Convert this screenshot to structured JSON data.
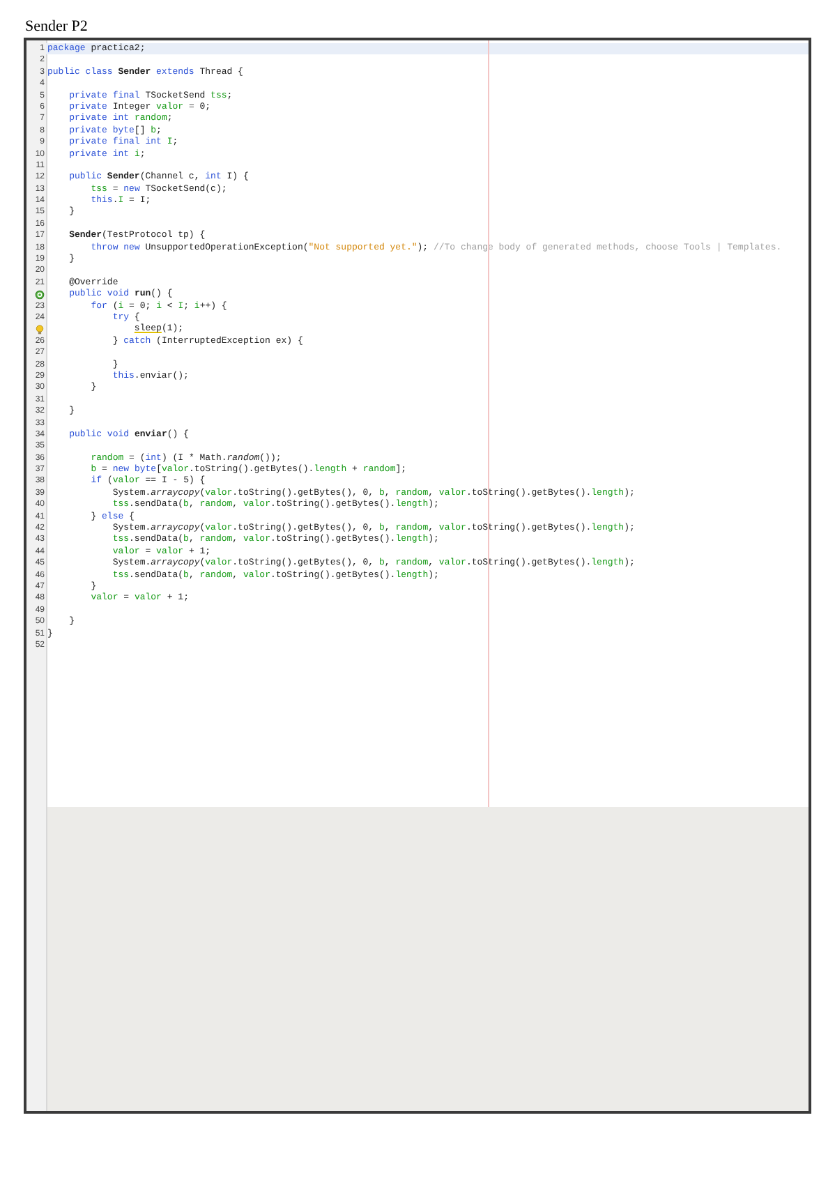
{
  "page_title": "Sender P2",
  "lines": [
    {
      "number": "1",
      "current": true,
      "tokens": [
        {
          "kind": "kw",
          "text": "package"
        },
        {
          "kind": "p",
          "text": " practica2;"
        }
      ]
    },
    {
      "number": "2",
      "current": false
    },
    {
      "number": "3",
      "current": false,
      "tokens": [
        {
          "kind": "kw",
          "text": "public class "
        },
        {
          "kind": "b",
          "text": "Sender"
        },
        {
          "kind": "kw",
          "text": " extends"
        },
        {
          "kind": "p",
          "text": " Thread {"
        }
      ]
    },
    {
      "number": "4",
      "current": false
    },
    {
      "number": "5",
      "current": false,
      "tokens": [
        {
          "kind": "kw",
          "text": "    private final"
        },
        {
          "kind": "p",
          "text": " TSocketSend "
        },
        {
          "kind": "f",
          "text": "tss"
        },
        {
          "kind": "p",
          "text": ";"
        }
      ]
    },
    {
      "number": "6",
      "current": false,
      "tokens": [
        {
          "kind": "kw",
          "text": "    private"
        },
        {
          "kind": "p",
          "text": " Integer "
        },
        {
          "kind": "f",
          "text": "valor"
        },
        {
          "kind": "p",
          "text": " = 0;"
        }
      ]
    },
    {
      "number": "7",
      "current": false,
      "tokens": [
        {
          "kind": "kw",
          "text": "    private int"
        },
        {
          "kind": "f",
          "text": " random"
        },
        {
          "kind": "p",
          "text": ";"
        }
      ]
    },
    {
      "number": "8",
      "current": false,
      "tokens": [
        {
          "kind": "kw",
          "text": "    private byte"
        },
        {
          "kind": "p",
          "text": "[] "
        },
        {
          "kind": "f",
          "text": "b"
        },
        {
          "kind": "p",
          "text": ";"
        }
      ]
    },
    {
      "number": "9",
      "current": false,
      "tokens": [
        {
          "kind": "kw",
          "text": "    private final int"
        },
        {
          "kind": "f",
          "text": " I"
        },
        {
          "kind": "p",
          "text": ";"
        }
      ]
    },
    {
      "number": "10",
      "current": false,
      "tokens": [
        {
          "kind": "kw",
          "text": "    private int"
        },
        {
          "kind": "f",
          "text": " i"
        },
        {
          "kind": "p",
          "text": ";"
        }
      ]
    },
    {
      "number": "11",
      "current": false
    },
    {
      "number": "12",
      "current": false,
      "tokens": [
        {
          "kind": "kw",
          "text": "    public"
        },
        {
          "kind": "b",
          "text": " Sender"
        },
        {
          "kind": "p",
          "text": "(Channel c, "
        },
        {
          "kind": "kw",
          "text": "int"
        },
        {
          "kind": "p",
          "text": " I) {"
        }
      ]
    },
    {
      "number": "13",
      "current": false,
      "tokens": [
        {
          "kind": "f",
          "text": "        tss"
        },
        {
          "kind": "p",
          "text": " = "
        },
        {
          "kind": "kw",
          "text": "new"
        },
        {
          "kind": "p",
          "text": " TSocketSend(c);"
        }
      ]
    },
    {
      "number": "14",
      "current": false,
      "tokens": [
        {
          "kind": "kw",
          "text": "        this"
        },
        {
          "kind": "p",
          "text": "."
        },
        {
          "kind": "f",
          "text": "I"
        },
        {
          "kind": "p",
          "text": " = I;"
        }
      ]
    },
    {
      "number": "15",
      "current": false,
      "tokens": [
        {
          "kind": "p",
          "text": "    }"
        }
      ]
    },
    {
      "number": "16",
      "current": false
    },
    {
      "number": "17",
      "current": false,
      "tokens": [
        {
          "kind": "b",
          "text": "    Sender"
        },
        {
          "kind": "p",
          "text": "(TestProtocol tp) {"
        }
      ]
    },
    {
      "number": "18",
      "current": false,
      "tokens": [
        {
          "kind": "kw",
          "text": "        throw new"
        },
        {
          "kind": "p",
          "text": " UnsupportedOperationException("
        },
        {
          "kind": "s",
          "text": "\"Not supported yet.\""
        },
        {
          "kind": "p",
          "text": "); "
        },
        {
          "kind": "c",
          "text": "//To change body of generated methods, choose Tools | Templates."
        }
      ]
    },
    {
      "number": "19",
      "current": false,
      "tokens": [
        {
          "kind": "p",
          "text": "    }"
        }
      ]
    },
    {
      "number": "20",
      "current": false
    },
    {
      "number": "21",
      "current": false,
      "tokens": [
        {
          "kind": "p",
          "text": "    @Override"
        }
      ]
    },
    {
      "kind": "override",
      "current": false,
      "tokens": [
        {
          "kind": "kw",
          "text": "    public void"
        },
        {
          "kind": "b",
          "text": " run"
        },
        {
          "kind": "p",
          "text": "() {"
        }
      ]
    },
    {
      "number": "23",
      "current": false,
      "tokens": [
        {
          "kind": "kw",
          "text": "        for"
        },
        {
          "kind": "p",
          "text": " ("
        },
        {
          "kind": "f",
          "text": "i"
        },
        {
          "kind": "p",
          "text": " = 0; "
        },
        {
          "kind": "f",
          "text": "i"
        },
        {
          "kind": "p",
          "text": " < "
        },
        {
          "kind": "f",
          "text": "I"
        },
        {
          "kind": "p",
          "text": "; "
        },
        {
          "kind": "f",
          "text": "i"
        },
        {
          "kind": "p",
          "text": "++) {"
        }
      ]
    },
    {
      "number": "24",
      "current": false,
      "tokens": [
        {
          "kind": "kw",
          "text": "            try"
        },
        {
          "kind": "p",
          "text": " {"
        }
      ]
    },
    {
      "kind": "warning",
      "current": false,
      "tokens": [
        {
          "kind": "w",
          "text": "                sleep"
        },
        {
          "kind": "p",
          "text": "(1);"
        }
      ]
    },
    {
      "number": "26",
      "current": false,
      "tokens": [
        {
          "kind": "p",
          "text": "            } "
        },
        {
          "kind": "kw",
          "text": "catch"
        },
        {
          "kind": "p",
          "text": " (InterruptedException ex) {"
        }
      ]
    },
    {
      "number": "27",
      "current": false
    },
    {
      "number": "28",
      "current": false,
      "tokens": [
        {
          "kind": "p",
          "text": "            }"
        }
      ]
    },
    {
      "number": "29",
      "current": false,
      "tokens": [
        {
          "kind": "kw",
          "text": "            this"
        },
        {
          "kind": "p",
          "text": ".enviar();"
        }
      ]
    },
    {
      "number": "30",
      "current": false,
      "tokens": [
        {
          "kind": "p",
          "text": "        }"
        }
      ]
    },
    {
      "number": "31",
      "current": false
    },
    {
      "number": "32",
      "current": false,
      "tokens": [
        {
          "kind": "p",
          "text": "    }"
        }
      ]
    },
    {
      "number": "33",
      "current": false
    },
    {
      "number": "34",
      "current": false,
      "tokens": [
        {
          "kind": "kw",
          "text": "    public void"
        },
        {
          "kind": "b",
          "text": " enviar"
        },
        {
          "kind": "p",
          "text": "() {"
        }
      ]
    },
    {
      "number": "35",
      "current": false
    },
    {
      "number": "36",
      "current": false,
      "tokens": [
        {
          "kind": "f",
          "text": "        random"
        },
        {
          "kind": "p",
          "text": " = ("
        },
        {
          "kind": "kw",
          "text": "int"
        },
        {
          "kind": "p",
          "text": ") (I * Math."
        },
        {
          "kind": "i",
          "text": "random"
        },
        {
          "kind": "p",
          "text": "());"
        }
      ]
    },
    {
      "number": "37",
      "current": false,
      "tokens": [
        {
          "kind": "f",
          "text": "        b"
        },
        {
          "kind": "p",
          "text": " = "
        },
        {
          "kind": "kw",
          "text": "new byte"
        },
        {
          "kind": "p",
          "text": "["
        },
        {
          "kind": "f",
          "text": "valor"
        },
        {
          "kind": "p",
          "text": ".toString().getBytes()."
        },
        {
          "kind": "f",
          "text": "length"
        },
        {
          "kind": "p",
          "text": " + "
        },
        {
          "kind": "f",
          "text": "random"
        },
        {
          "kind": "p",
          "text": "];"
        }
      ]
    },
    {
      "number": "38",
      "current": false,
      "tokens": [
        {
          "kind": "kw",
          "text": "        if"
        },
        {
          "kind": "p",
          "text": " ("
        },
        {
          "kind": "f",
          "text": "valor"
        },
        {
          "kind": "p",
          "text": " == I - 5) {"
        }
      ]
    },
    {
      "number": "39",
      "current": false,
      "tokens": [
        {
          "kind": "p",
          "text": "            System."
        },
        {
          "kind": "i",
          "text": "arraycopy"
        },
        {
          "kind": "p",
          "text": "("
        },
        {
          "kind": "f",
          "text": "valor"
        },
        {
          "kind": "p",
          "text": ".toString().getBytes(), 0, "
        },
        {
          "kind": "f",
          "text": "b"
        },
        {
          "kind": "p",
          "text": ", "
        },
        {
          "kind": "f",
          "text": "random"
        },
        {
          "kind": "p",
          "text": ", "
        },
        {
          "kind": "f",
          "text": "valor"
        },
        {
          "kind": "p",
          "text": ".toString().getBytes()."
        },
        {
          "kind": "f",
          "text": "length"
        },
        {
          "kind": "p",
          "text": ");"
        }
      ]
    },
    {
      "number": "40",
      "current": false,
      "tokens": [
        {
          "kind": "f",
          "text": "            tss"
        },
        {
          "kind": "p",
          "text": ".sendData("
        },
        {
          "kind": "f",
          "text": "b"
        },
        {
          "kind": "p",
          "text": ", "
        },
        {
          "kind": "f",
          "text": "random"
        },
        {
          "kind": "p",
          "text": ", "
        },
        {
          "kind": "f",
          "text": "valor"
        },
        {
          "kind": "p",
          "text": ".toString().getBytes()."
        },
        {
          "kind": "f",
          "text": "length"
        },
        {
          "kind": "p",
          "text": ");"
        }
      ]
    },
    {
      "number": "41",
      "current": false,
      "tokens": [
        {
          "kind": "p",
          "text": "        } "
        },
        {
          "kind": "kw",
          "text": "else"
        },
        {
          "kind": "p",
          "text": " {"
        }
      ]
    },
    {
      "number": "42",
      "current": false,
      "tokens": [
        {
          "kind": "p",
          "text": "            System."
        },
        {
          "kind": "i",
          "text": "arraycopy"
        },
        {
          "kind": "p",
          "text": "("
        },
        {
          "kind": "f",
          "text": "valor"
        },
        {
          "kind": "p",
          "text": ".toString().getBytes(), 0, "
        },
        {
          "kind": "f",
          "text": "b"
        },
        {
          "kind": "p",
          "text": ", "
        },
        {
          "kind": "f",
          "text": "random"
        },
        {
          "kind": "p",
          "text": ", "
        },
        {
          "kind": "f",
          "text": "valor"
        },
        {
          "kind": "p",
          "text": ".toString().getBytes()."
        },
        {
          "kind": "f",
          "text": "length"
        },
        {
          "kind": "p",
          "text": ");"
        }
      ]
    },
    {
      "number": "43",
      "current": false,
      "tokens": [
        {
          "kind": "f",
          "text": "            tss"
        },
        {
          "kind": "p",
          "text": ".sendData("
        },
        {
          "kind": "f",
          "text": "b"
        },
        {
          "kind": "p",
          "text": ", "
        },
        {
          "kind": "f",
          "text": "random"
        },
        {
          "kind": "p",
          "text": ", "
        },
        {
          "kind": "f",
          "text": "valor"
        },
        {
          "kind": "p",
          "text": ".toString().getBytes()."
        },
        {
          "kind": "f",
          "text": "length"
        },
        {
          "kind": "p",
          "text": ");"
        }
      ]
    },
    {
      "number": "44",
      "current": false,
      "tokens": [
        {
          "kind": "f",
          "text": "            valor"
        },
        {
          "kind": "p",
          "text": " = "
        },
        {
          "kind": "f",
          "text": "valor"
        },
        {
          "kind": "p",
          "text": " + 1;"
        }
      ]
    },
    {
      "number": "45",
      "current": false,
      "tokens": [
        {
          "kind": "p",
          "text": "            System."
        },
        {
          "kind": "i",
          "text": "arraycopy"
        },
        {
          "kind": "p",
          "text": "("
        },
        {
          "kind": "f",
          "text": "valor"
        },
        {
          "kind": "p",
          "text": ".toString().getBytes(), 0, "
        },
        {
          "kind": "f",
          "text": "b"
        },
        {
          "kind": "p",
          "text": ", "
        },
        {
          "kind": "f",
          "text": "random"
        },
        {
          "kind": "p",
          "text": ", "
        },
        {
          "kind": "f",
          "text": "valor"
        },
        {
          "kind": "p",
          "text": ".toString().getBytes()."
        },
        {
          "kind": "f",
          "text": "length"
        },
        {
          "kind": "p",
          "text": ");"
        }
      ]
    },
    {
      "number": "46",
      "current": false,
      "tokens": [
        {
          "kind": "f",
          "text": "            tss"
        },
        {
          "kind": "p",
          "text": ".sendData("
        },
        {
          "kind": "f",
          "text": "b"
        },
        {
          "kind": "p",
          "text": ", "
        },
        {
          "kind": "f",
          "text": "random"
        },
        {
          "kind": "p",
          "text": ", "
        },
        {
          "kind": "f",
          "text": "valor"
        },
        {
          "kind": "p",
          "text": ".toString().getBytes()."
        },
        {
          "kind": "f",
          "text": "length"
        },
        {
          "kind": "p",
          "text": ");"
        }
      ]
    },
    {
      "number": "47",
      "current": false,
      "tokens": [
        {
          "kind": "p",
          "text": "        }"
        }
      ]
    },
    {
      "number": "48",
      "current": false,
      "tokens": [
        {
          "kind": "f",
          "text": "        valor"
        },
        {
          "kind": "p",
          "text": " = "
        },
        {
          "kind": "f",
          "text": "valor"
        },
        {
          "kind": "p",
          "text": " + 1;"
        }
      ]
    },
    {
      "number": "49",
      "current": false
    },
    {
      "number": "50",
      "current": false,
      "tokens": [
        {
          "kind": "p",
          "text": "    }"
        }
      ]
    },
    {
      "number": "51",
      "current": false,
      "tokens": [
        {
          "kind": "p",
          "text": "}"
        }
      ]
    },
    {
      "number": "52",
      "current": false
    }
  ]
}
